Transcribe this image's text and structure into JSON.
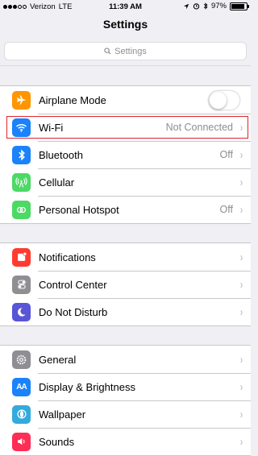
{
  "status_bar": {
    "carrier": "Verizon",
    "network": "LTE",
    "time": "11:39 AM",
    "battery": "97%",
    "battery_level": 0.97
  },
  "nav": {
    "title": "Settings"
  },
  "search": {
    "placeholder": "Settings"
  },
  "groups": [
    [
      {
        "label": "Airplane Mode",
        "icon": "airplane-icon",
        "color": "#ff9500",
        "toggle": false
      },
      {
        "label": "Wi-Fi",
        "icon": "wifi-icon",
        "color": "#1a82fb",
        "value": "Not Connected"
      },
      {
        "label": "Bluetooth",
        "icon": "bluetooth-icon",
        "color": "#1a82fb",
        "value": "Off"
      },
      {
        "label": "Cellular",
        "icon": "cellular-icon",
        "color": "#4cd964"
      },
      {
        "label": "Personal Hotspot",
        "icon": "hotspot-icon",
        "color": "#4cd964",
        "value": "Off"
      }
    ],
    [
      {
        "label": "Notifications",
        "icon": "notifications-icon",
        "color": "#ff3b30"
      },
      {
        "label": "Control Center",
        "icon": "control-center-icon",
        "color": "#8e8e93"
      },
      {
        "label": "Do Not Disturb",
        "icon": "moon-icon",
        "color": "#5856d6"
      }
    ],
    [
      {
        "label": "General",
        "icon": "gear-icon",
        "color": "#8e8e93"
      },
      {
        "label": "Display & Brightness",
        "icon": "display-icon",
        "color": "#1a82fb"
      },
      {
        "label": "Wallpaper",
        "icon": "wallpaper-icon",
        "color": "#34aadc"
      },
      {
        "label": "Sounds",
        "icon": "sounds-icon",
        "color": "#ff2d55"
      }
    ]
  ],
  "highlight_color": "#e0242e"
}
